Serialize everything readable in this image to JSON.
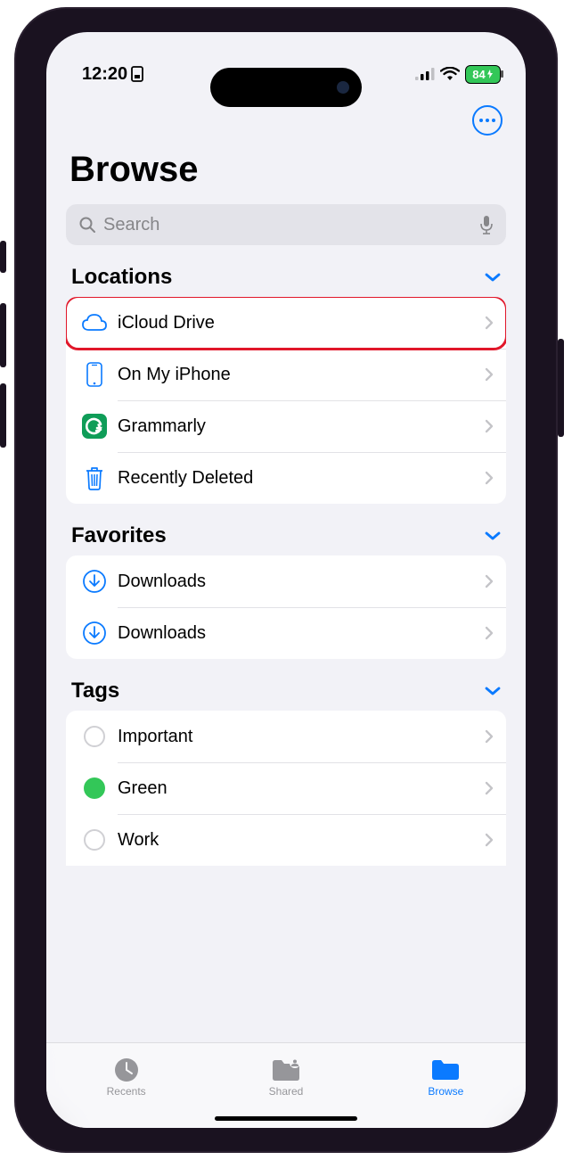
{
  "status": {
    "time": "12:20",
    "battery": "84"
  },
  "page": {
    "title": "Browse"
  },
  "search": {
    "placeholder": "Search"
  },
  "sections": {
    "locations": {
      "title": "Locations",
      "items": [
        {
          "label": "iCloud Drive"
        },
        {
          "label": "On My iPhone"
        },
        {
          "label": "Grammarly"
        },
        {
          "label": "Recently Deleted"
        }
      ]
    },
    "favorites": {
      "title": "Favorites",
      "items": [
        {
          "label": "Downloads"
        },
        {
          "label": "Downloads"
        }
      ]
    },
    "tags": {
      "title": "Tags",
      "items": [
        {
          "label": "Important"
        },
        {
          "label": "Green"
        },
        {
          "label": "Work"
        }
      ]
    }
  },
  "tabs": {
    "recents": "Recents",
    "shared": "Shared",
    "browse": "Browse"
  }
}
